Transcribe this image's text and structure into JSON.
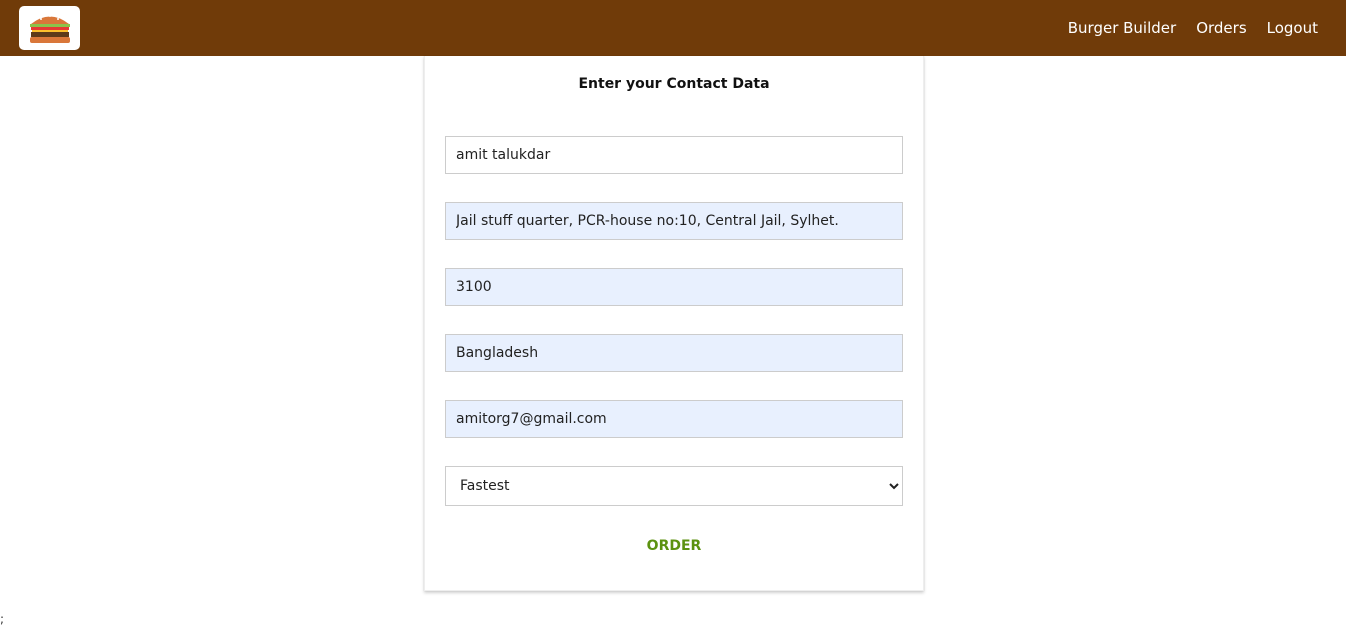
{
  "header": {
    "logo_icon": "burger-logo-icon",
    "nav": [
      {
        "label": "Burger Builder"
      },
      {
        "label": "Orders"
      },
      {
        "label": "Logout"
      }
    ],
    "background": "#703b09"
  },
  "form": {
    "title": "Enter your Contact Data",
    "name": "amit talukdar",
    "street": "Jail stuff quarter, PCR-house no:10, Central Jail, Sylhet.",
    "zip": "3100",
    "country": "Bangladesh",
    "email": "amitorg7@gmail.com",
    "delivery_method": "Fastest",
    "order_label": "ORDER",
    "order_color": "#5c9210"
  },
  "footer_text": ";"
}
